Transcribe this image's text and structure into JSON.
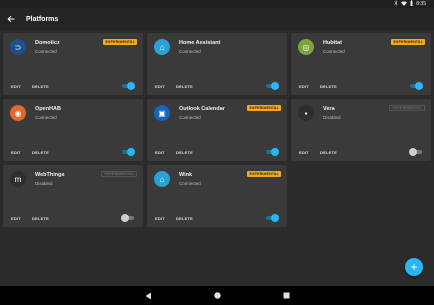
{
  "status_bar": {
    "time": "8:35",
    "icons": [
      "bluetooth-icon",
      "wifi-icon",
      "battery-icon"
    ]
  },
  "app_bar": {
    "title": "Platforms",
    "back_icon": "arrow-back-icon"
  },
  "colors": {
    "accent": "#29b6f6",
    "badge": "#f5a623",
    "card_bg": "#3a3a3a",
    "page_bg": "#2b2b2b"
  },
  "labels": {
    "edit": "EDIT",
    "delete": "DELETE"
  },
  "platforms": [
    {
      "name": "Domoticz",
      "status": "Connected",
      "badge": "EXPERIMENTAL",
      "badge_active": true,
      "enabled": true,
      "icon": "domoticz-logo",
      "logo_color": "#1f4f8f",
      "glyph": "⊃"
    },
    {
      "name": "Home Assistant",
      "status": "Connected",
      "badge": "",
      "badge_active": false,
      "enabled": true,
      "icon": "home-assistant-logo",
      "logo_color": "#2aa1d6",
      "glyph": "⌂"
    },
    {
      "name": "Hubitat",
      "status": "Connected",
      "badge": "EXPERIMENTAL",
      "badge_active": true,
      "enabled": true,
      "icon": "hubitat-logo",
      "logo_color": "#7ca43a",
      "glyph": "◎"
    },
    {
      "name": "OpenHAB",
      "status": "Connected",
      "badge": "",
      "badge_active": false,
      "enabled": true,
      "icon": "openhab-logo",
      "logo_color": "#e2682b",
      "glyph": "◉"
    },
    {
      "name": "Outlook Calendar",
      "status": "Connected",
      "badge": "EXPERIMENTAL",
      "badge_active": true,
      "enabled": true,
      "icon": "outlook-logo",
      "logo_color": "#1565c0",
      "glyph": "▣"
    },
    {
      "name": "Vera",
      "status": "Disabled",
      "badge": "EXPERIMENTAL",
      "badge_active": false,
      "enabled": false,
      "icon": "vera-logo",
      "logo_color": "#2e2e2e",
      "glyph": "▪"
    },
    {
      "name": "WebThings",
      "status": "Disabled",
      "badge": "EXPERIMENTAL",
      "badge_active": false,
      "enabled": false,
      "icon": "webthings-logo",
      "logo_color": "#2e2e2e",
      "glyph": "m"
    },
    {
      "name": "Wink",
      "status": "Connected",
      "badge": "EXPERIMENTAL",
      "badge_active": true,
      "enabled": true,
      "icon": "wink-logo",
      "logo_color": "#2aa1d6",
      "glyph": "⌂"
    }
  ],
  "fab": {
    "icon": "add-icon"
  },
  "nav_bar": {
    "icons": [
      "back-triangle-icon",
      "home-circle-icon",
      "recents-square-icon"
    ]
  }
}
